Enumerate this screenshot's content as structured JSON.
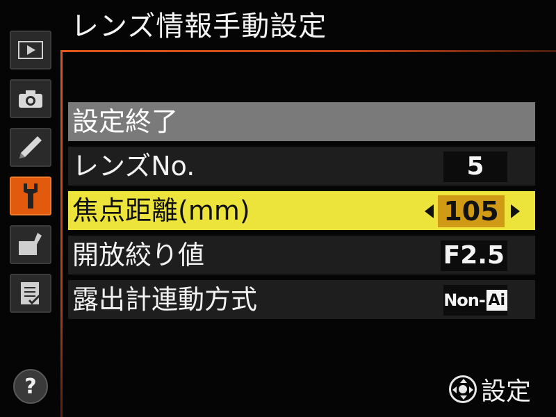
{
  "header": {
    "title": "レンズ情報手動設定"
  },
  "sidebar": {
    "tabs": [
      {
        "icon": "playback-icon",
        "active": false
      },
      {
        "icon": "camera-icon",
        "active": false
      },
      {
        "icon": "pencil-icon",
        "active": false
      },
      {
        "icon": "wrench-icon",
        "active": true
      },
      {
        "icon": "retouch-icon",
        "active": false
      },
      {
        "icon": "my-menu-icon",
        "active": false
      }
    ],
    "help_label": "?"
  },
  "menu": {
    "items": [
      {
        "label": "設定終了",
        "value": ""
      },
      {
        "label": "レンズNo.",
        "value": "5"
      },
      {
        "label": "焦点距離(mm)",
        "value": "105"
      },
      {
        "label": "開放絞り値",
        "value": "F2.5"
      },
      {
        "label": "露出計連動方式",
        "value": "Non-AI",
        "value_text": "Non-",
        "value_box": "Ai"
      }
    ],
    "selected_index": 2
  },
  "footer": {
    "label": "設定",
    "icon": "multi-selector-icon"
  },
  "colors": {
    "accent_orange": "#e25a0e",
    "selected_row": "#ece43a",
    "selected_value": "#d19a14",
    "exit_row": "#7a7a7a"
  }
}
